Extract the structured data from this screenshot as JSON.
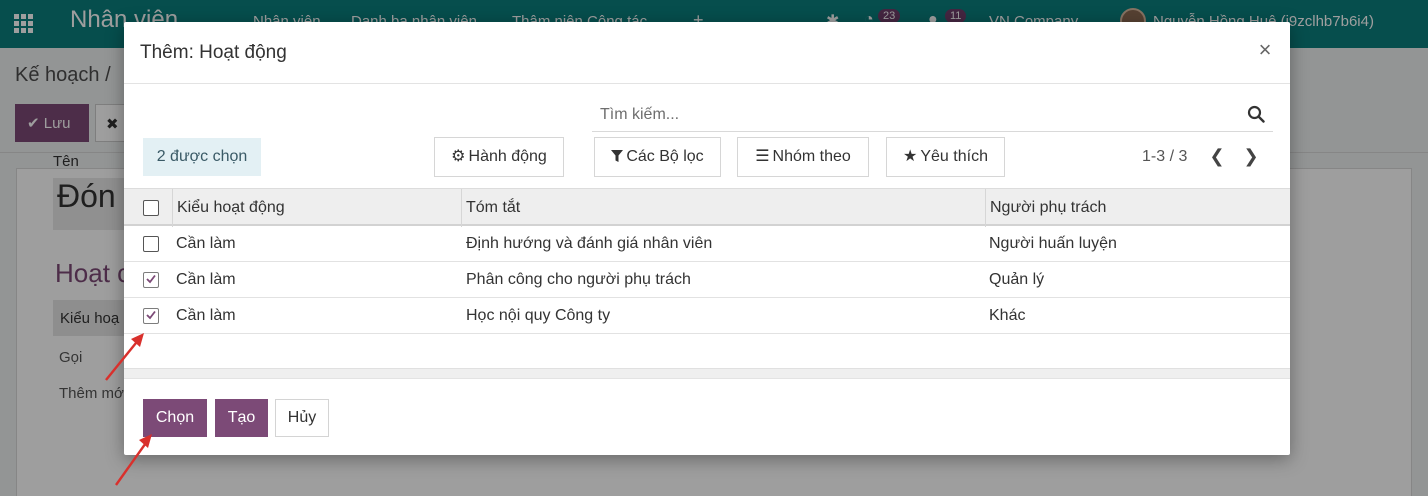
{
  "navbar": {
    "app_name": "Nhân viên",
    "menus": [
      "Nhân viên",
      "Danh bạ nhân viên",
      "Thâm niên Công tác"
    ],
    "plus": "+",
    "activity_count": "23",
    "message_count": "11",
    "company": "VN Company",
    "user": "Nguyễn Hồng Huệ (i9zclhb7b6i4)"
  },
  "background": {
    "breadcrumb": "Kế hoạch /",
    "save_label": "Lưu",
    "discard_glyph": "✖",
    "field_label": "Tên",
    "field_value": "Đón",
    "section_title": "Hoạt c",
    "table_header": "Kiểu hoạ",
    "row_1": "Gọi",
    "row_2": "Thêm mớ"
  },
  "modal": {
    "title": "Thêm: Hoạt động",
    "close_glyph": "×",
    "search": {
      "placeholder": "Tìm kiếm..."
    },
    "selected_label": "2 được chọn",
    "buttons": {
      "actions": "Hành động",
      "filters": "Các Bộ lọc",
      "group_by": "Nhóm theo",
      "favorites": "Yêu thích"
    },
    "pager": {
      "value": "1-3 / 3",
      "prev": "❮",
      "next": "❯"
    },
    "columns": [
      "Kiểu hoạt động",
      "Tóm tắt",
      "Người phụ trách"
    ],
    "rows": [
      {
        "type": "Cần làm",
        "summary": "Định hướng và đánh giá nhân viên",
        "assignee": "Người huấn luyện",
        "checked": false
      },
      {
        "type": "Cần làm",
        "summary": "Phân công cho người phụ trách",
        "assignee": "Quản lý",
        "checked": true
      },
      {
        "type": "Cần làm",
        "summary": "Học nội quy Công ty",
        "assignee": "Khác",
        "checked": true
      }
    ],
    "footer": {
      "select_label": "Chọn",
      "create_label": "Tạo",
      "cancel_label": "Hủy"
    }
  },
  "colors": {
    "navbar": "#0a7e7c",
    "primary": "#7c4a77",
    "annotation_arrow": "#d9302c"
  }
}
